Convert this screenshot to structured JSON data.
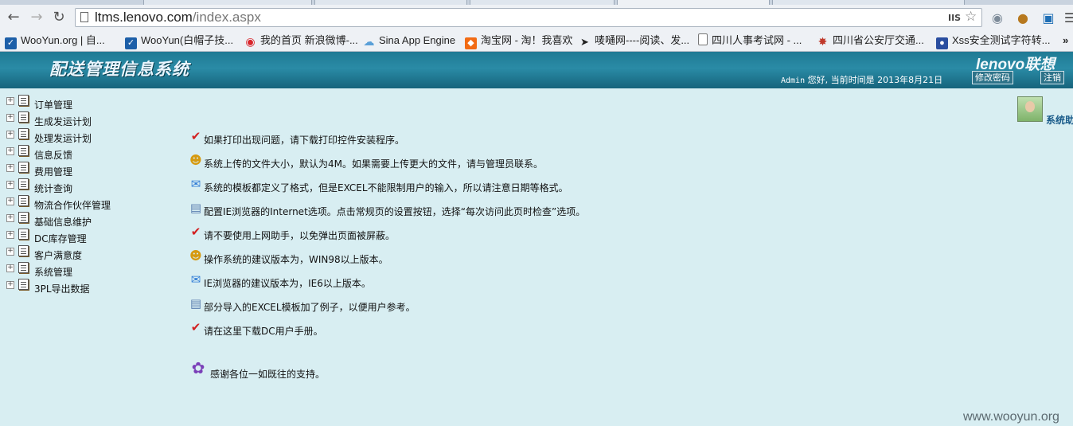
{
  "browser": {
    "url_host": "ltms.lenovo.com",
    "url_path": "/index.aspx",
    "mode_badge": "IIS",
    "bookmarks": [
      {
        "label": "WooYun.org | 自...",
        "icon": "wooyun-icon"
      },
      {
        "label": "WooYun(白帽子技...",
        "icon": "wooyun-icon"
      },
      {
        "label": "我的首页 新浪微博-...",
        "icon": "weibo-icon"
      },
      {
        "label": "Sina App Engine",
        "icon": "cloud-icon"
      },
      {
        "label": "淘宝网 - 淘！我喜欢",
        "icon": "taobao-icon"
      },
      {
        "label": "唛嗵网----阅读、发...",
        "icon": "bird-icon"
      },
      {
        "label": "四川人事考试网 - ...",
        "icon": "page-icon"
      },
      {
        "label": "四川省公安厅交通...",
        "icon": "police-badge-icon"
      },
      {
        "label": "Xss安全测试字符转...",
        "icon": "paw-icon"
      }
    ]
  },
  "header": {
    "title": "配送管理信息系统",
    "brand": "lenovo联想",
    "user": "Admin",
    "greeting": " 您好, 当前时间是 2013年8月21日",
    "change_password": "修改密码",
    "logout": "注销"
  },
  "sidebar": {
    "items": [
      {
        "label": "订单管理"
      },
      {
        "label": "生成发运计划"
      },
      {
        "label": "处理发运计划"
      },
      {
        "label": "信息反馈"
      },
      {
        "label": "费用管理"
      },
      {
        "label": "统计查询"
      },
      {
        "label": "物流合作伙伴管理"
      },
      {
        "label": "基础信息维护"
      },
      {
        "label": "DC库存管理"
      },
      {
        "label": "客户满意度"
      },
      {
        "label": "系统管理"
      },
      {
        "label": "3PL导出数据"
      }
    ]
  },
  "notices": [
    {
      "text": "如果打印出现问题，请下载打印控件安装程序。",
      "icon": "check-icon"
    },
    {
      "text": "系统上传的文件大小，默认为4M。如果需要上传更大的文件，请与管理员联系。",
      "icon": "users-icon"
    },
    {
      "text": "系统的模板都定义了格式，但是EXCEL不能限制用户的输入，所以请注意日期等格式。",
      "icon": "chat-bubble-icon"
    },
    {
      "text": "配置IE浏览器的Internet选项。点击常规页的设置按钮，选择“每次访问此页时检查”选项。",
      "icon": "document-icon"
    },
    {
      "text": "请不要使用上网助手，以免弹出页面被屏蔽。",
      "icon": "check-icon"
    },
    {
      "text": "操作系统的建议版本为，WIN98以上版本。",
      "icon": "users-icon"
    },
    {
      "text": "IE浏览器的建议版本为，IE6以上版本。",
      "icon": "chat-bubble-icon"
    },
    {
      "text": "部分导入的EXCEL模板加了例子，以便用户参考。",
      "icon": "document-icon"
    },
    {
      "text": "请在这里下载DC用户手册。",
      "icon": "check-icon"
    }
  ],
  "thanks": "感谢各位一如既往的支持。",
  "assistant_label": "系统助",
  "watermark": "www.wooyun.org"
}
